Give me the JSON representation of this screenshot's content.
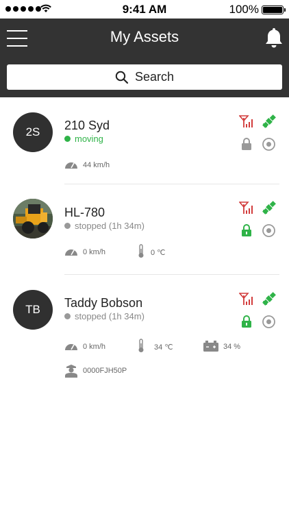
{
  "status_bar": {
    "time": "9:41 AM",
    "battery_percent": "100%"
  },
  "header": {
    "title": "My Assets",
    "search_label": "Search"
  },
  "colors": {
    "header_bg": "#333333",
    "green": "#2fb348",
    "red": "#d23b3b",
    "gray": "#999999"
  },
  "assets": [
    {
      "avatar_text": "2S",
      "name": "210 Syd",
      "status": "moving",
      "status_color": "#2fb348",
      "speed": "44 km/h",
      "lock_state": "locked-gray"
    },
    {
      "avatar_text": "",
      "avatar_image": "loader-photo",
      "name": "HL-780",
      "status": "stopped (1h 34m)",
      "status_color": "#999999",
      "speed": "0 km/h",
      "temperature": "0 ℃",
      "lock_state": "unlocked-green"
    },
    {
      "avatar_text": "TB",
      "name": "Taddy Bobson",
      "status": "stopped (1h 34m)",
      "status_color": "#999999",
      "speed": "0 km/h",
      "temperature": "34 ℃",
      "battery": "34 %",
      "driver_id": "0000FJH50P",
      "lock_state": "unlocked-green"
    }
  ]
}
